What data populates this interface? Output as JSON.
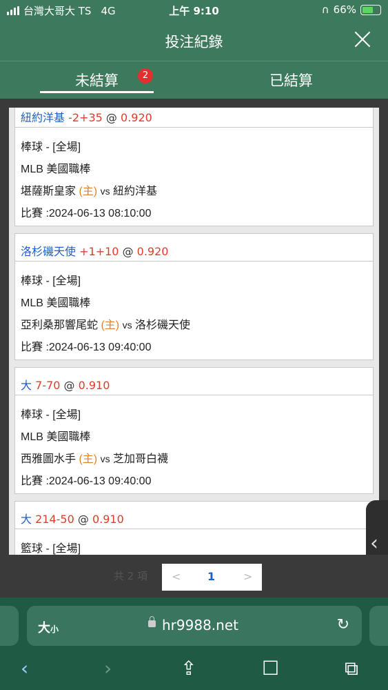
{
  "status": {
    "carrier": "台灣大哥大 TS",
    "network": "4G",
    "time": "上午 9:10",
    "battery": "66%"
  },
  "header": {
    "title": "投注紀錄"
  },
  "tabs": [
    {
      "label": "未結算",
      "badge": "2"
    },
    {
      "label": "已結算"
    }
  ],
  "bets": [
    {
      "team": "紐約洋基",
      "line": "-2+35",
      "at": "@",
      "odds": "0.920",
      "sport": "棒球 - [全場]",
      "league": "MLB 美國職棒",
      "home_team": "堪薩斯皇家",
      "home_tag": "(主)",
      "vs": "vs",
      "away_team": "紐約洋基",
      "match_time": "比賽 :2024-06-13 08:10:00"
    },
    {
      "team": "洛杉磯天使",
      "line": "+1+10",
      "at": "@",
      "odds": "0.920",
      "sport": "棒球 - [全場]",
      "league": "MLB 美國職棒",
      "home_team": "亞利桑那響尾蛇",
      "home_tag": "(主)",
      "vs": "vs",
      "away_team": "洛杉磯天使",
      "match_time": "比賽 :2024-06-13 09:40:00"
    },
    {
      "team": "大",
      "line": "7-70",
      "at": "@",
      "odds": "0.910",
      "sport": "棒球 - [全場]",
      "league": "MLB 美國職棒",
      "home_team": "西雅圖水手",
      "home_tag": "(主)",
      "vs": "vs",
      "away_team": "芝加哥白襪",
      "match_time": "比賽 :2024-06-13 09:40:00"
    },
    {
      "team": "大",
      "line": "214-50",
      "at": "@",
      "odds": "0.910",
      "sport": "籃球 - [全場]"
    }
  ],
  "pager": {
    "total": "共 2 項",
    "prev": "<",
    "page": "1",
    "next": ">"
  },
  "side_handle": "‹",
  "browser": {
    "text_size": "大",
    "text_size_small": "小",
    "url": "hr9988.net",
    "icons": [
      "back-icon",
      "forward-icon",
      "share-icon",
      "bookmarks-icon",
      "tabs-icon",
      "reload-icon",
      "lock-icon"
    ]
  },
  "colors": {
    "header_green": "#3d7a5c",
    "browser_green": "#1f5a45",
    "team_blue": "#1f5fc7",
    "odds_red": "#e23a2a",
    "home_orange": "#e0812a",
    "badge_red": "#e03030"
  }
}
